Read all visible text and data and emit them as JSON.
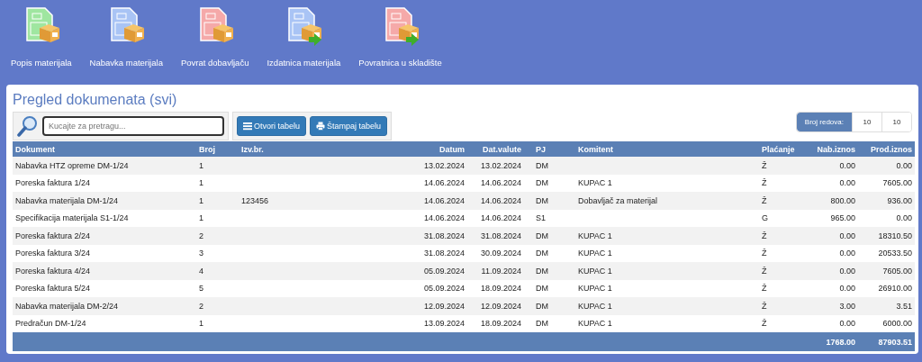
{
  "toolbar": [
    {
      "label": "Popis materijala",
      "color": "#9fe6a0",
      "kind": "box"
    },
    {
      "label": "Nabavka materijala",
      "color": "#a9c4f5",
      "kind": "box"
    },
    {
      "label": "Povrat dobavljaču",
      "color": "#f5a9a9",
      "kind": "box"
    },
    {
      "label": "Izdatnica materijala",
      "color": "#a9c4f5",
      "kind": "box-arrow"
    },
    {
      "label": "Povratnica u skladište",
      "color": "#f5a9a9",
      "kind": "box-arrow"
    }
  ],
  "panel": {
    "title": "Pregled dokumenata (svi)",
    "search": {
      "placeholder": "Kucajte za pretragu..."
    },
    "buttons": [
      {
        "label": "Otvori tabelu",
        "kind": "list"
      },
      {
        "label": "Štampaj tabelu",
        "kind": "print"
      }
    ],
    "rows_per_page": {
      "label": "Broj redova:",
      "values": [
        "10",
        "10"
      ]
    },
    "table": {
      "columns": [
        "Dokument",
        "Broj",
        "Izv.br.",
        "Datum",
        "Dat.valute",
        "PJ",
        "Komitent",
        "Plaćanje",
        "Nab.iznos",
        "Prod.iznos"
      ],
      "rows": [
        {
          "dokument": "Nabavka HTZ opreme DM-1/24",
          "broj": "1",
          "datum": "13.02.2024",
          "dat_valute": "13.02.2024",
          "pj": "DM",
          "placanje": "Ž",
          "nab_iznos": "0.00",
          "prod_iznos": "0.00"
        },
        {
          "dokument": "Poreska faktura 1/24",
          "broj": "1",
          "datum": "14.06.2024",
          "dat_valute": "14.06.2024",
          "pj": "DM",
          "komitent": "KUPAC 1",
          "placanje": "Ž",
          "nab_iznos": "0.00",
          "prod_iznos": "7605.00"
        },
        {
          "dokument": "Nabavka materijala DM-1/24",
          "broj": "1",
          "izv_br": "123456",
          "datum": "14.06.2024",
          "dat_valute": "14.06.2024",
          "pj": "DM",
          "komitent": "Dobavljač za materijal",
          "placanje": "Ž",
          "nab_iznos": "800.00",
          "prod_iznos": "936.00"
        },
        {
          "dokument": "Specifikacija materijala S1-1/24",
          "broj": "1",
          "datum": "14.06.2024",
          "dat_valute": "14.06.2024",
          "pj": "S1",
          "placanje": "G",
          "nab_iznos": "965.00",
          "prod_iznos": "0.00"
        },
        {
          "dokument": "Poreska faktura 2/24",
          "broj": "2",
          "datum": "31.08.2024",
          "dat_valute": "31.08.2024",
          "pj": "DM",
          "komitent": "KUPAC 1",
          "placanje": "Ž",
          "nab_iznos": "0.00",
          "prod_iznos": "18310.50"
        },
        {
          "dokument": "Poreska faktura 3/24",
          "broj": "3",
          "datum": "31.08.2024",
          "dat_valute": "30.09.2024",
          "pj": "DM",
          "komitent": "KUPAC 1",
          "placanje": "Ž",
          "nab_iznos": "0.00",
          "prod_iznos": "20533.50"
        },
        {
          "dokument": "Poreska faktura 4/24",
          "broj": "4",
          "datum": "05.09.2024",
          "dat_valute": "11.09.2024",
          "pj": "DM",
          "komitent": "KUPAC 1",
          "placanje": "Ž",
          "nab_iznos": "0.00",
          "prod_iznos": "7605.00"
        },
        {
          "dokument": "Poreska faktura 5/24",
          "broj": "5",
          "datum": "05.09.2024",
          "dat_valute": "18.09.2024",
          "pj": "DM",
          "komitent": "KUPAC 1",
          "placanje": "Ž",
          "nab_iznos": "0.00",
          "prod_iznos": "26910.00"
        },
        {
          "dokument": "Nabavka materijala DM-2/24",
          "broj": "2",
          "datum": "12.09.2024",
          "dat_valute": "12.09.2024",
          "pj": "DM",
          "komitent": "KUPAC 1",
          "placanje": "Ž",
          "nab_iznos": "3.00",
          "prod_iznos": "3.51"
        },
        {
          "dokument": "Predračun DM-1/24",
          "broj": "1",
          "datum": "13.09.2024",
          "dat_valute": "18.09.2024",
          "pj": "DM",
          "komitent": "KUPAC 1",
          "placanje": "Ž",
          "nab_iznos": "0.00",
          "prod_iznos": "6000.00"
        }
      ],
      "totals": {
        "nab_iznos": "1768.00",
        "prod_iznos": "87903.51"
      }
    }
  }
}
